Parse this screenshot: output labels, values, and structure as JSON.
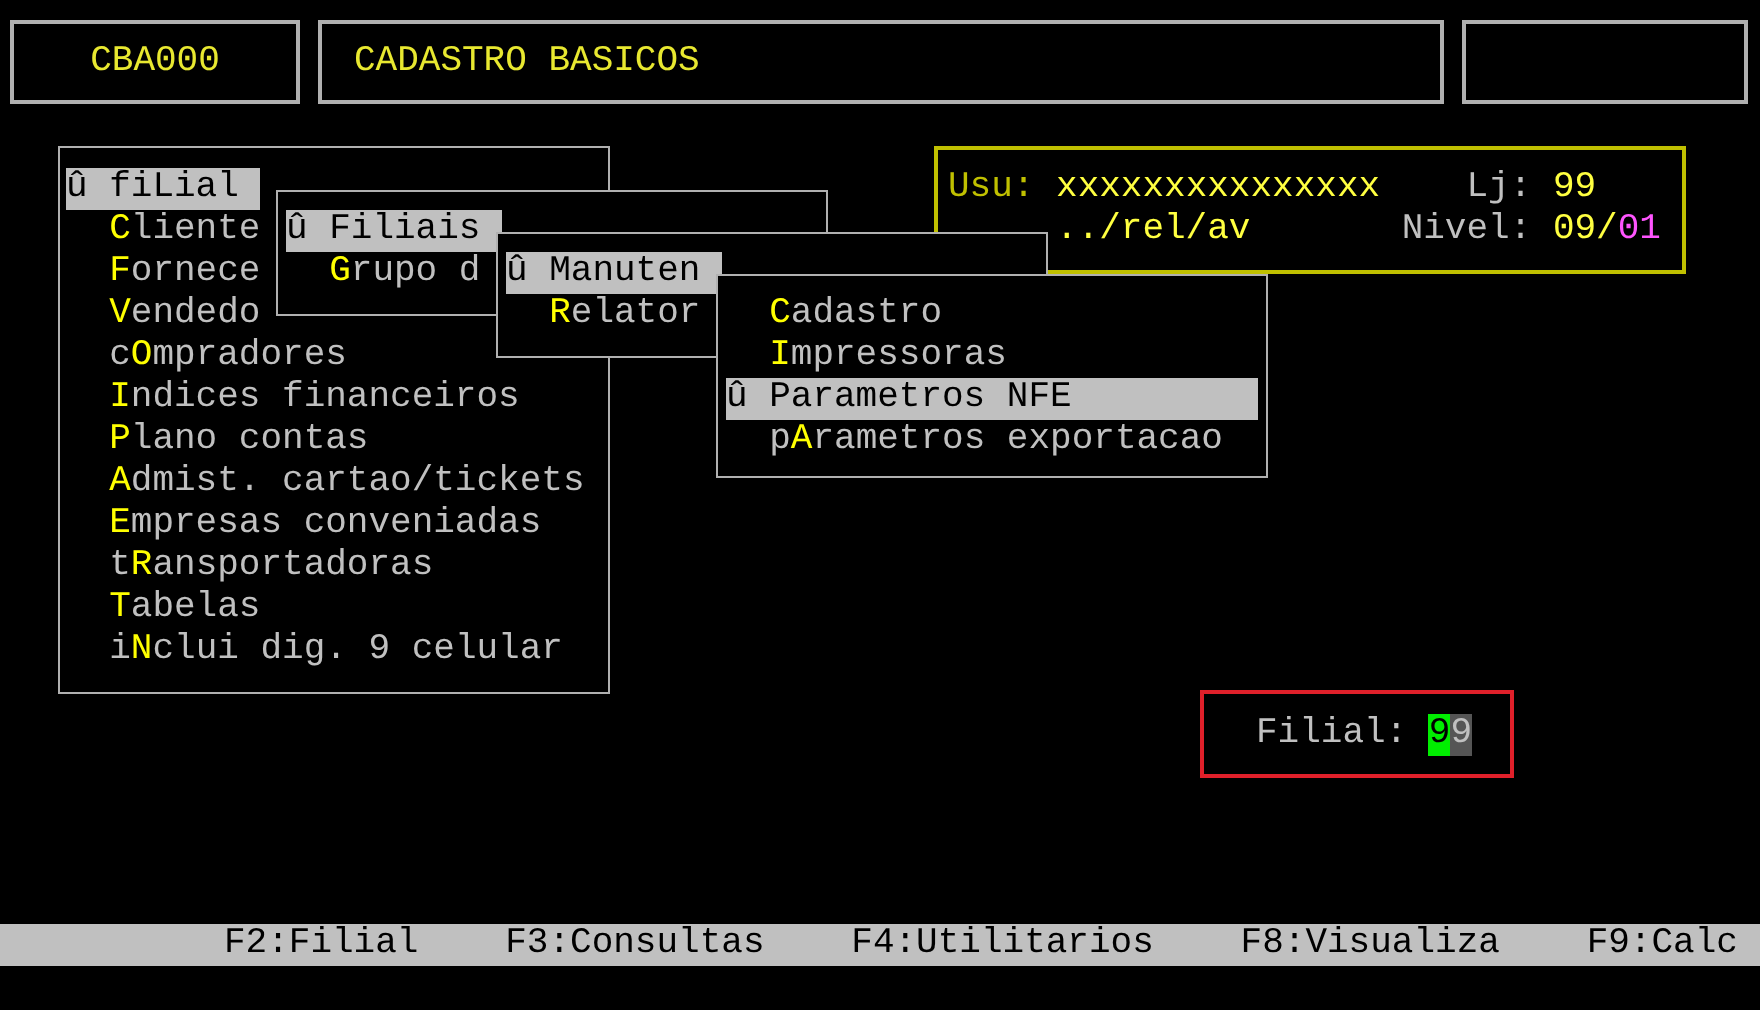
{
  "title_bar": {
    "program_code": "CBA000",
    "title": "CADASTRO BASICOS"
  },
  "menus": [
    {
      "items": [
        {
          "marker": "û",
          "text": "fiLial",
          "selected": true
        },
        {
          "hotkey": "C",
          "rest": "liente",
          "selected": false
        },
        {
          "hotkey": "F",
          "rest": "ornece",
          "selected": false
        },
        {
          "hotkey": "V",
          "rest": "endedo",
          "selected": false
        },
        {
          "prefix": "c",
          "hotkey": "O",
          "rest": "mpradores",
          "selected": false
        },
        {
          "hotkey": "I",
          "rest": "ndices financeiros",
          "selected": false
        },
        {
          "hotkey": "P",
          "rest": "lano contas",
          "selected": false
        },
        {
          "hotkey": "A",
          "rest": "dmist. cartao/tickets",
          "selected": false
        },
        {
          "hotkey": "E",
          "rest": "mpresas conveniadas",
          "selected": false
        },
        {
          "prefix": "t",
          "hotkey": "R",
          "rest": "ansportadoras",
          "selected": false
        },
        {
          "hotkey": "T",
          "rest": "abelas",
          "selected": false
        },
        {
          "prefix": "i",
          "hotkey": "N",
          "rest": "clui dig. 9 celular",
          "selected": false
        }
      ]
    },
    {
      "items": [
        {
          "marker": "û",
          "text": "Filiais",
          "selected": true
        },
        {
          "hotkey": "G",
          "rest": "rupo d",
          "selected": false
        }
      ]
    },
    {
      "items": [
        {
          "marker": "û",
          "text": "Manuten",
          "selected": true
        },
        {
          "hotkey": "R",
          "rest": "elator",
          "selected": false
        }
      ]
    },
    {
      "items": [
        {
          "hotkey": "C",
          "rest": "adastro",
          "selected": false
        },
        {
          "hotkey": "I",
          "rest": "mpressoras",
          "selected": false
        },
        {
          "marker": "û",
          "text": "Parametros NFE",
          "selected": true
        },
        {
          "prefix": "p",
          "hotkey": "A",
          "rest": "rametros exportacao",
          "selected": false
        }
      ]
    }
  ],
  "user_panel": {
    "user_label": "Usu:",
    "user": "xxxxxxxxxxxxxxx",
    "store_label": "Lj:",
    "store": "99",
    "path": "../rel/av",
    "level_label": "Nivel:",
    "level_major": "09/",
    "level_minor": "01"
  },
  "filial_field": {
    "label": "Filial:",
    "value": "99"
  },
  "function_keys": [
    "F2:Filial",
    "F3:Consultas",
    "F4:Utilitarios",
    "F8:Visualiza",
    "F9:Calc"
  ]
}
